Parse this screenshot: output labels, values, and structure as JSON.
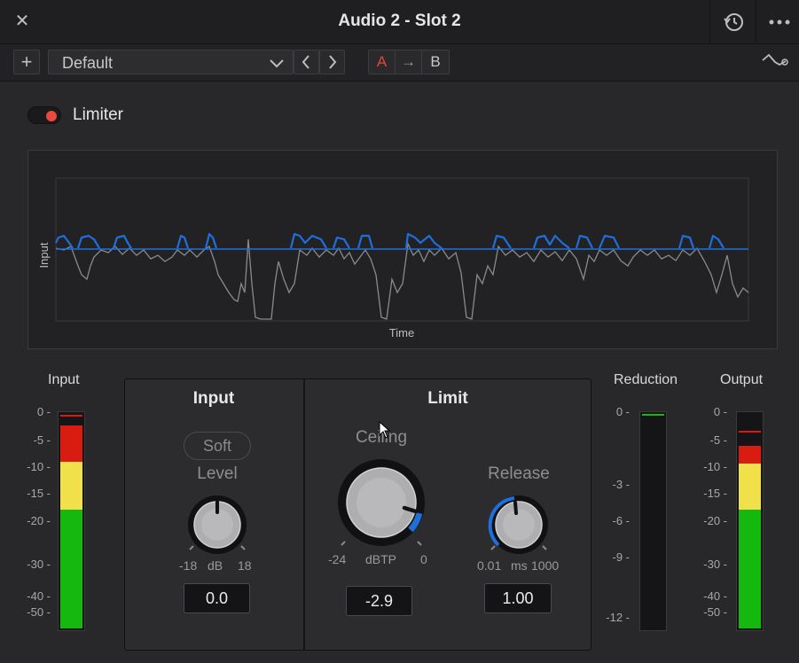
{
  "window": {
    "title": "Audio 2 - Slot 2",
    "close_icon": "close-icon",
    "reset_icon": "reset-history-icon",
    "more_icon": "more-options-icon"
  },
  "toolbar": {
    "add_label": "+",
    "preset_value": "Default",
    "prev_label": "<",
    "next_label": ">",
    "ab_a": "A",
    "ab_arrow": "→",
    "ab_b": "B"
  },
  "limiter": {
    "label": "Limiter",
    "enabled": true,
    "active_color": "#e84a3d"
  },
  "graph": {
    "y_label": "Input",
    "x_label": "Time",
    "threshold_color": "#1e6fd9",
    "signal_color": "#8a8a8a"
  },
  "input_meter": {
    "label": "Input",
    "scale": [
      "0 -",
      "-5 -",
      "-10 -",
      "-15 -",
      "-20 -",
      "-30 -",
      "-40 -",
      "-50 -"
    ],
    "level_red": 0.83,
    "level_peak": 0.98
  },
  "input_section": {
    "title": "Input",
    "soft_label": "Soft",
    "level_label": "Level",
    "min_label": "-18",
    "unit_label": "dB",
    "max_label": "18",
    "value": "0.0"
  },
  "limit_section": {
    "title": "Limit",
    "ceiling_label": "Ceiling",
    "ceiling_min": "-24",
    "ceiling_unit": "dBTP",
    "ceiling_max": "0",
    "ceiling_value": "-2.9",
    "release_label": "Release",
    "release_min": "0.01",
    "release_unit": "ms",
    "release_max": "1000",
    "release_value": "1.00"
  },
  "reduction_meter": {
    "label": "Reduction",
    "scale": [
      "0 -",
      "-3 -",
      "-6 -",
      "-9 -",
      "-12 -"
    ]
  },
  "output_meter": {
    "label": "Output",
    "scale": [
      "0 -",
      "-5 -",
      "-10 -",
      "-15 -",
      "-20 -",
      "-30 -",
      "-40 -",
      "-50 -"
    ],
    "level_red": 0.9,
    "level_peak": 0.95
  }
}
